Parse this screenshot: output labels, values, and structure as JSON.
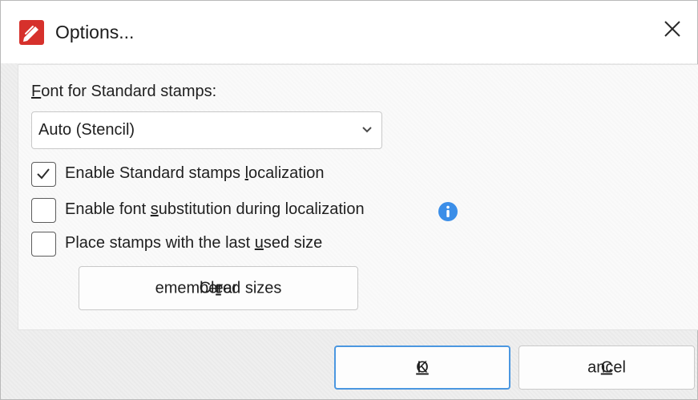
{
  "window": {
    "title": "Options..."
  },
  "font_section": {
    "label_first": "F",
    "label_rest": "ont for Standard stamps:",
    "font_select": {
      "value": "Auto (Stencil)"
    }
  },
  "checkboxes": [
    {
      "pre": "Enable Standard stamps ",
      "accel": "l",
      "post": "ocalization",
      "checked": true
    },
    {
      "pre": "Enable font ",
      "accel": "s",
      "post": "ubstitution during localization",
      "checked": false
    },
    {
      "pre": "Place stamps with the last ",
      "accel": "u",
      "post": "sed size",
      "checked": false
    }
  ],
  "clear_button": {
    "pre": "Clear ",
    "accel": "r",
    "post": "emembered sizes"
  },
  "footer": {
    "ok": {
      "accel": "O",
      "post": "K"
    },
    "cancel": {
      "accel": "C",
      "post": "ancel"
    }
  },
  "colors": {
    "accent": "#4b97e0",
    "app_icon": "#d6312c",
    "info_icon": "#3b8ee8"
  },
  "icons": {
    "app": "pdf-editor-app-icon",
    "close": "close-icon",
    "dropdown": "chevron-down-icon",
    "check": "checkmark-icon",
    "info": "info-icon"
  }
}
